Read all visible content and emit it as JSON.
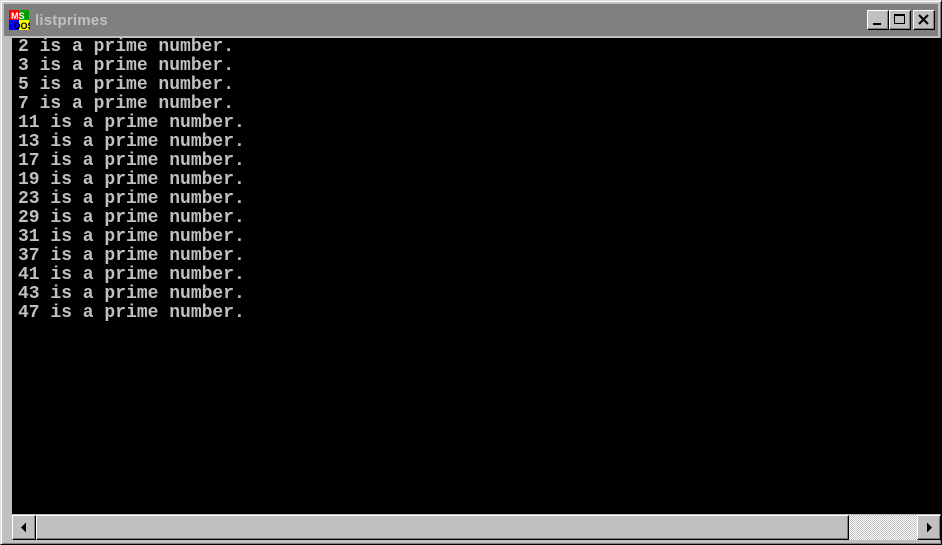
{
  "window": {
    "title": "listprimes",
    "app_icon": "ms-dos-icon",
    "controls": [
      "minimize-icon",
      "maximize-icon",
      "close-icon"
    ]
  },
  "console": {
    "lines": [
      "2 is a prime number.",
      "3 is a prime number.",
      "5 is a prime number.",
      "7 is a prime number.",
      "11 is a prime number.",
      "13 is a prime number.",
      "17 is a prime number.",
      "19 is a prime number.",
      "23 is a prime number.",
      "29 is a prime number.",
      "31 is a prime number.",
      "37 is a prime number.",
      "41 is a prime number.",
      "43 is a prime number.",
      "47 is a prime number."
    ],
    "background": "#000000",
    "text_color": "#c0c0c0"
  },
  "scrollbar": {
    "left_arrow": "left-arrow-icon",
    "right_arrow": "right-arrow-icon"
  }
}
